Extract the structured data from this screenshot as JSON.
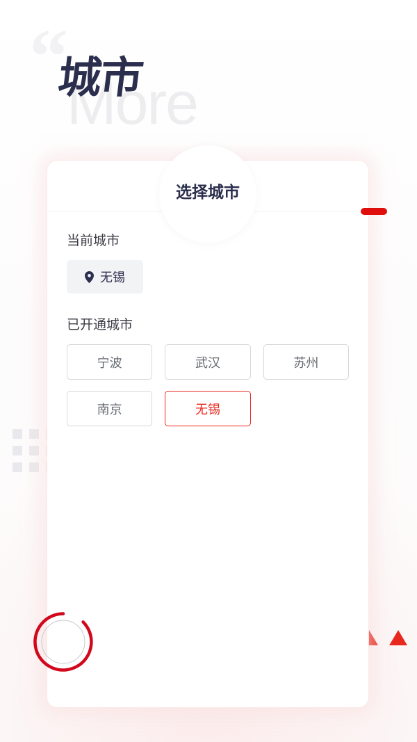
{
  "hero": {
    "quote_mark": "“",
    "watermark": "More",
    "title": "城市"
  },
  "card": {
    "header_title": "选择城市",
    "current_section": {
      "label": "当前城市",
      "icon": "location-pin-icon",
      "value": "无锡"
    },
    "open_section": {
      "label": "已开通城市",
      "cities": [
        {
          "name": "宁波",
          "selected": false
        },
        {
          "name": "武汉",
          "selected": false
        },
        {
          "name": "苏州",
          "selected": false
        },
        {
          "name": "南京",
          "selected": false
        },
        {
          "name": "无锡",
          "selected": true
        }
      ]
    }
  },
  "decorations": {
    "dot_grid": "dot-grid-decoration",
    "triangles": "triangle-row-decoration",
    "red_tab": "red-accent-tab",
    "spinner": "loading-spinner-icon"
  },
  "colors": {
    "accent_red": "#e8281e",
    "tab_red": "#e00d0d",
    "title_navy": "#2b2e4d",
    "border_gray": "#d7d7da",
    "pill_gray": "#f2f3f5",
    "watermark_gray": "#ededef",
    "page_bg": "#fdfbfb"
  }
}
